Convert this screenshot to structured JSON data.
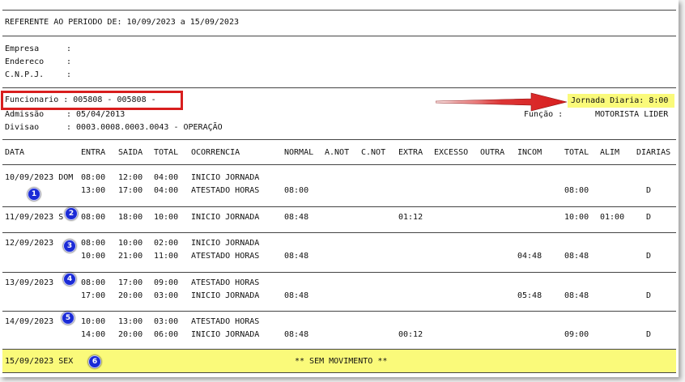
{
  "header": {
    "periodo": "REFERENTE AO PERIODO DE: 10/09/2023 a 15/09/2023",
    "empresa_label": "Empresa",
    "endereco_label": "Endereco",
    "cnpj_label": "C.N.P.J.",
    "sep": ":"
  },
  "funcionario": {
    "line": "Funcionario : 005808 - 005808 -",
    "admissao_label": "Admissão",
    "admissao_value": ": 05/04/2013",
    "divisao_label": "Divisao",
    "divisao_value": ": 0003.0008.0003.0043 - OPERAÇÃO",
    "jornada": "Jornada Diaria: 8:00",
    "funcao_label": "Função :",
    "funcao_value": "MOTORISTA LIDER"
  },
  "columns": [
    "DATA",
    "ENTRA",
    "SAIDA",
    "TOTAL",
    "OCORRENCIA",
    "NORMAL",
    "A.NOT",
    "C.NOT",
    "EXTRA",
    "EXCESSO",
    "OUTRA",
    "INCOM",
    "TOTAL",
    "ALIM",
    "DIARIAS"
  ],
  "days": [
    {
      "date": "10/09/2023 DOM",
      "badge": "1",
      "rows": [
        {
          "entra": "08:00",
          "saida": "12:00",
          "total": "04:00",
          "ocorrencia": "INICIO JORNADA",
          "normal": "",
          "extra": "",
          "incom": "",
          "total2": "",
          "alim": "",
          "diarias": ""
        },
        {
          "entra": "13:00",
          "saida": "17:00",
          "total": "04:00",
          "ocorrencia": "ATESTADO HORAS",
          "normal": "08:00",
          "extra": "",
          "incom": "",
          "total2": "08:00",
          "alim": "",
          "diarias": "D"
        }
      ]
    },
    {
      "date": "11/09/2023 S",
      "badge": "2",
      "rows": [
        {
          "entra": "08:00",
          "saida": "18:00",
          "total": "10:00",
          "ocorrencia": "INICIO JORNADA",
          "normal": "08:48",
          "extra": "01:12",
          "incom": "",
          "total2": "10:00",
          "alim": "01:00",
          "diarias": "D"
        }
      ]
    },
    {
      "date": "12/09/2023",
      "badge": "3",
      "rows": [
        {
          "entra": "08:00",
          "saida": "10:00",
          "total": "02:00",
          "ocorrencia": "INICIO JORNADA",
          "normal": "",
          "extra": "",
          "incom": "",
          "total2": "",
          "alim": "",
          "diarias": ""
        },
        {
          "entra": "10:00",
          "saida": "21:00",
          "total": "11:00",
          "ocorrencia": "ATESTADO HORAS",
          "normal": "08:48",
          "extra": "",
          "incom": "04:48",
          "total2": "08:48",
          "alim": "",
          "diarias": "D"
        }
      ]
    },
    {
      "date": "13/09/2023",
      "badge": "4",
      "rows": [
        {
          "entra": "08:00",
          "saida": "17:00",
          "total": "09:00",
          "ocorrencia": "ATESTADO HORAS",
          "normal": "",
          "extra": "",
          "incom": "",
          "total2": "",
          "alim": "",
          "diarias": ""
        },
        {
          "entra": "17:00",
          "saida": "20:00",
          "total": "03:00",
          "ocorrencia": "INICIO JORNADA",
          "normal": "08:48",
          "extra": "",
          "incom": "05:48",
          "total2": "08:48",
          "alim": "",
          "diarias": "D"
        }
      ]
    },
    {
      "date": "14/09/2023",
      "badge": "5",
      "rows": [
        {
          "entra": "10:00",
          "saida": "13:00",
          "total": "03:00",
          "ocorrencia": "ATESTADO HORAS",
          "normal": "",
          "extra": "",
          "incom": "",
          "total2": "",
          "alim": "",
          "diarias": ""
        },
        {
          "entra": "14:00",
          "saida": "20:00",
          "total": "06:00",
          "ocorrencia": "INICIO JORNADA",
          "normal": "08:48",
          "extra": "00:12",
          "incom": "",
          "total2": "09:00",
          "alim": "",
          "diarias": "D"
        }
      ]
    }
  ],
  "last_day": {
    "date": "15/09/2023 SEX",
    "badge": "6",
    "message": "** SEM MOVIMENTO **"
  },
  "colors": {
    "highlight": "#fafa7a",
    "annotation_red": "#d81e1e",
    "badge_blue": "#1b2bd6"
  }
}
